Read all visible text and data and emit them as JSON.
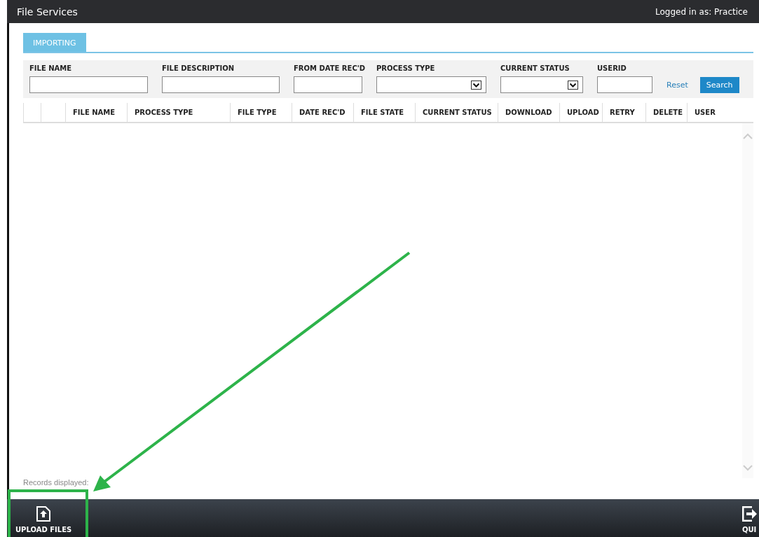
{
  "window": {
    "title": "File Services",
    "login": "Logged in as: Practice"
  },
  "tabs": [
    {
      "label": "IMPORTING",
      "selected": true
    }
  ],
  "filters": [
    {
      "kind": "text",
      "label": "FILE NAME"
    },
    {
      "kind": "text",
      "label": "FILE DESCRIPTION"
    },
    {
      "kind": "text",
      "label": "FROM DATE REC'D"
    },
    {
      "kind": "select",
      "label": "PROCESS TYPE"
    },
    {
      "kind": "select",
      "label": "CURRENT STATUS"
    },
    {
      "kind": "text",
      "label": "USERID"
    }
  ],
  "reset_link": "Reset",
  "search_button": "Search",
  "table": {
    "columns": [
      "",
      "",
      "FILE NAME",
      "PROCESS TYPE",
      "FILE TYPE",
      "DATE REC'D",
      "FILE STATE",
      "CURRENT STATUS",
      "DOWNLOAD",
      "UPLOAD",
      "RETRY",
      "DELETE",
      "USER"
    ]
  },
  "records_label": "Records displayed:",
  "toolbar": [
    {
      "kind": "upload",
      "label": "UPLOAD FILES"
    },
    {
      "kind": "quit",
      "label": "QUI"
    }
  ]
}
